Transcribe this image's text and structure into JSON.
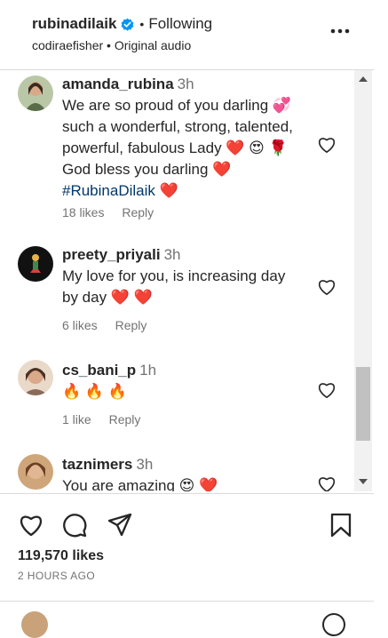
{
  "header": {
    "username": "rubinadilaik",
    "separator": "•",
    "follow_status": "Following",
    "audio_user": "codiraefisher",
    "audio_separator": "•",
    "audio_label": "Original audio"
  },
  "comments": [
    {
      "username": "amanda_rubina",
      "time": "3h",
      "lines": [
        "We are so proud of you darling 💞",
        "such a wonderful, strong, talented,",
        "powerful, fabulous Lady ❤️ 😍 🌹",
        "God bless you darling ❤️"
      ],
      "hashtag": "#RubinaDilaik",
      "hashtag_suffix": "❤️",
      "likes": "18 likes",
      "reply": "Reply"
    },
    {
      "username": "preety_priyali",
      "time": "3h",
      "lines": [
        "My love for you, is increasing day",
        "by day ❤️ ❤️"
      ],
      "likes": "6 likes",
      "reply": "Reply"
    },
    {
      "username": "cs_bani_p",
      "time": "1h",
      "lines": [
        "🔥 🔥 🔥"
      ],
      "likes": "1 like",
      "reply": "Reply"
    },
    {
      "username": "taznimers",
      "time": "3h",
      "lines": [
        "You are amazing 😍 ❤️"
      ]
    }
  ],
  "post": {
    "likes": "119,570 likes",
    "time_ago": "2 HOURS AGO"
  },
  "icons": {
    "verified": "verified-badge-icon",
    "more": "more-options-icon",
    "like": "heart-icon",
    "comment": "comment-icon",
    "share": "share-icon",
    "save": "bookmark-icon"
  },
  "colors": {
    "verified": "#0095f6",
    "text": "#262626",
    "muted": "#737373",
    "hashtag": "#00376b"
  }
}
